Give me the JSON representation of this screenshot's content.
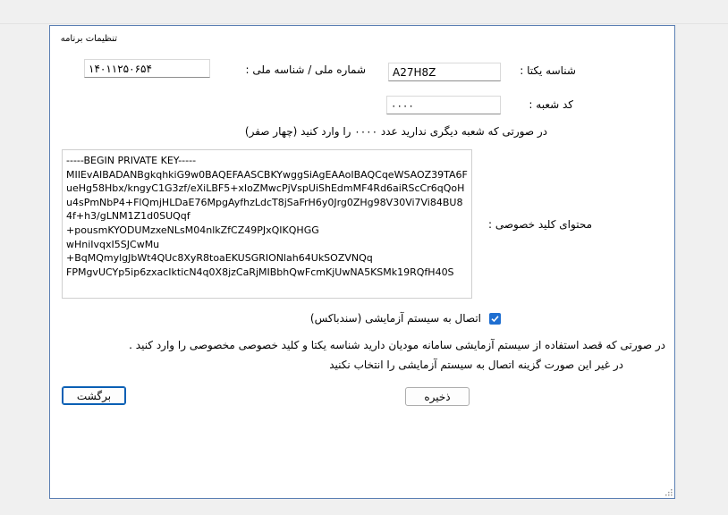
{
  "window": {
    "title": "تنظیمات برنامه"
  },
  "form": {
    "unique_id": {
      "label": "شناسه یکتا :",
      "value": "A27H8Z"
    },
    "national_id": {
      "label": "شماره ملی / شناسه ملی :",
      "value": "۱۴۰۱۱۲۵۰۶۵۴"
    },
    "branch_code": {
      "label": "کد شعبه :",
      "value": "۰۰۰۰"
    },
    "branch_hint": "در صورتی که شعبه دیگری ندارید  عدد ۰۰۰۰ را وارد کنید (چهار صفر)",
    "private_key": {
      "label": "محتوای کلید خصوصی :",
      "value": "-----BEGIN PRIVATE KEY-----\nMIIEvAIBADANBgkqhkiG9w0BAQEFAASCBKYwggSiAgEAAoIBAQCqeWSAOZ39TA6F\nueHg58Hbx/kngyC1G3zf/eXiLBF5+xIoZMwcPjVspUiShEdmMF4Rd6aiRScCr6qQoHu4sPmNbP4+FlQmjHLDaE76MpgAyfhzLdcT8jSaFrH6y0Jrg0ZHg98V30Vi7Vi84BU84f+h3/gLNM1Z1d0SUQqf\n+pousmKYODUMzxeNLsM04nlkZfCZ49PJxQIKQHGG\nwHniIvqxI5SJCwMu\n+BqMQmylgJbWt4QUc8XyR8toaEKUSGRIONlah64UkSOZVNQq\nFPMgvUCYp5ip6zxacIkticN4q0X8jzCaRjMIBbhQwFcmKjUwNA5KSMk19RQfH40S"
    },
    "sandbox": {
      "label": "اتصال به سیستم آزمایشی (سندباکس)",
      "checked": true
    },
    "sandbox_hint_1": "در صورتی که قصد استفاده از سیستم آزمایشی سامانه مودیان دارید شناسه یکتا و کلید خصوصی مخصوصی را وارد کنید .",
    "sandbox_hint_2": "در غیر این صورت گزینه اتصال به سیستم آزمایشی را انتخاب نکنید"
  },
  "buttons": {
    "save": "ذخیره",
    "back": "برگشت"
  },
  "colors": {
    "accent": "#1f6fd1",
    "border": "#5b7fb3"
  }
}
